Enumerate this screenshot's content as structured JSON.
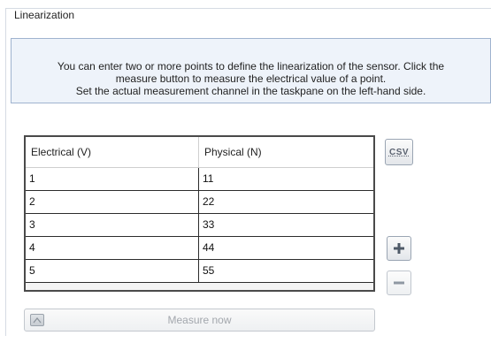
{
  "group": {
    "title": "Linearization"
  },
  "info": {
    "lines": [
      "You can enter two or more points to define the linearization of the sensor. Click the",
      "measure button to measure the electrical value of a point.",
      "Set the actual measurement channel in the taskpane on the left-hand side."
    ]
  },
  "table": {
    "columns": [
      "Electrical (V)",
      "Physical (N)"
    ],
    "rows": [
      [
        "1",
        "11"
      ],
      [
        "2",
        "22"
      ],
      [
        "3",
        "33"
      ],
      [
        "4",
        "44"
      ],
      [
        "5",
        "55"
      ]
    ]
  },
  "buttons": {
    "csv_label": "CSV",
    "measure_label": "Measure now",
    "add_icon": "plus-icon",
    "remove_icon": "minus-icon"
  },
  "colors": {
    "info_background": "#eef3fa",
    "info_border": "#9fb3cf",
    "table_border": "#4a4a4a"
  }
}
